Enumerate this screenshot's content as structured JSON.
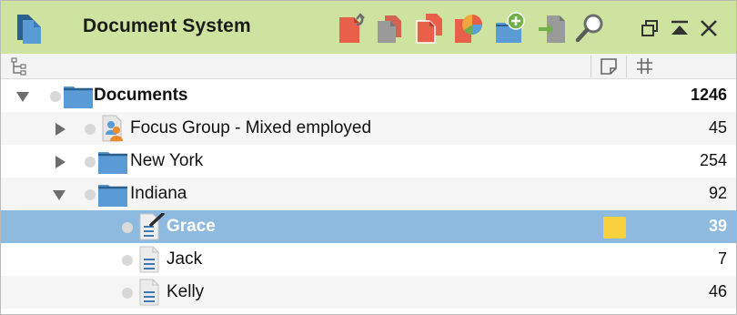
{
  "window": {
    "title": "Document System"
  },
  "toolbar": {
    "buttons": [
      {
        "icon": "retrieve-segments-icon",
        "color": "#e8604a"
      },
      {
        "icon": "copy-document-icon",
        "color": "#9a9a9a"
      },
      {
        "icon": "duplicate-document-icon",
        "color": "#e8604a"
      },
      {
        "icon": "document-chart-icon",
        "color": "#e8a23a"
      },
      {
        "icon": "new-document-group-icon",
        "color": "#5aa0d8"
      },
      {
        "icon": "import-document-icon",
        "color": "#6fb04a"
      },
      {
        "icon": "search-icon",
        "color": "#5aa0d8"
      }
    ]
  },
  "window_controls": [
    "restore-icon",
    "collapse-up-icon",
    "close-icon"
  ],
  "columns": {
    "tree_icon": "tree-structure-icon",
    "memo_icon": "memo-column-icon",
    "count_icon": "hash-icon"
  },
  "tree": {
    "rows": [
      {
        "label": "Documents",
        "count": "1246",
        "type": "folder",
        "expanded": true,
        "level": 0,
        "bold": true
      },
      {
        "label": "Focus Group - Mixed employed",
        "count": "45",
        "type": "focus-group",
        "expanded": false,
        "level": 1
      },
      {
        "label": "New York",
        "count": "254",
        "type": "folder",
        "expanded": false,
        "level": 1
      },
      {
        "label": "Indiana",
        "count": "92",
        "type": "folder",
        "expanded": true,
        "level": 1
      },
      {
        "label": "Grace",
        "count": "39",
        "type": "text-document-edit",
        "level": 2,
        "selected": true,
        "memo": true
      },
      {
        "label": "Jack",
        "count": "7",
        "type": "text-document",
        "level": 2
      },
      {
        "label": "Kelly",
        "count": "46",
        "type": "text-document",
        "level": 2
      }
    ]
  },
  "colors": {
    "titlebar": "#cfe3a0",
    "selection": "#8fbadf",
    "folder": "#5b9bd5",
    "memo": "#f7d23e"
  }
}
